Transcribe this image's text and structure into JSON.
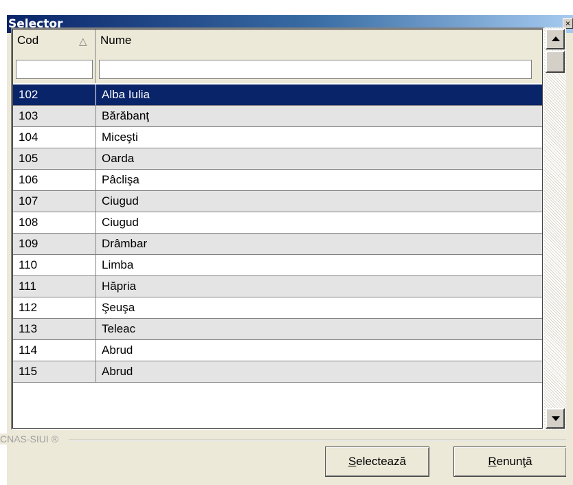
{
  "window": {
    "title": "Selector",
    "close_glyph": "×"
  },
  "grid": {
    "columns": [
      {
        "label": "Cod",
        "sort": "ascending",
        "sort_icon": "sort-up-icon"
      },
      {
        "label": "Nume"
      }
    ],
    "filters": {
      "cod": "",
      "nume": ""
    },
    "rows": [
      {
        "cod": "102",
        "nume": "Alba Iulia",
        "selected": true
      },
      {
        "cod": "103",
        "nume": "Bărăbanţ"
      },
      {
        "cod": "104",
        "nume": "Miceşti"
      },
      {
        "cod": "105",
        "nume": "Oarda"
      },
      {
        "cod": "106",
        "nume": "Pâclişa"
      },
      {
        "cod": "107",
        "nume": "Ciugud"
      },
      {
        "cod": "108",
        "nume": "Ciugud"
      },
      {
        "cod": "109",
        "nume": "Drâmbar"
      },
      {
        "cod": "110",
        "nume": "Limba"
      },
      {
        "cod": "111",
        "nume": "Hăpria"
      },
      {
        "cod": "112",
        "nume": "Şeuşa"
      },
      {
        "cod": "113",
        "nume": "Teleac"
      },
      {
        "cod": "114",
        "nume": "Abrud"
      },
      {
        "cod": "115",
        "nume": "Abrud"
      }
    ]
  },
  "footer": {
    "brand": "CNAS-SIUI ®"
  },
  "buttons": {
    "select": {
      "mnemonic": "S",
      "rest": "electează"
    },
    "cancel": {
      "mnemonic": "R",
      "rest": "enunţă"
    }
  },
  "colors": {
    "titlebar_start": "#0a246a",
    "titlebar_end": "#a6caf0",
    "selected_row": "#0a246a",
    "alt_row": "#e4e4e4",
    "dialog_face": "#ece9d8"
  }
}
